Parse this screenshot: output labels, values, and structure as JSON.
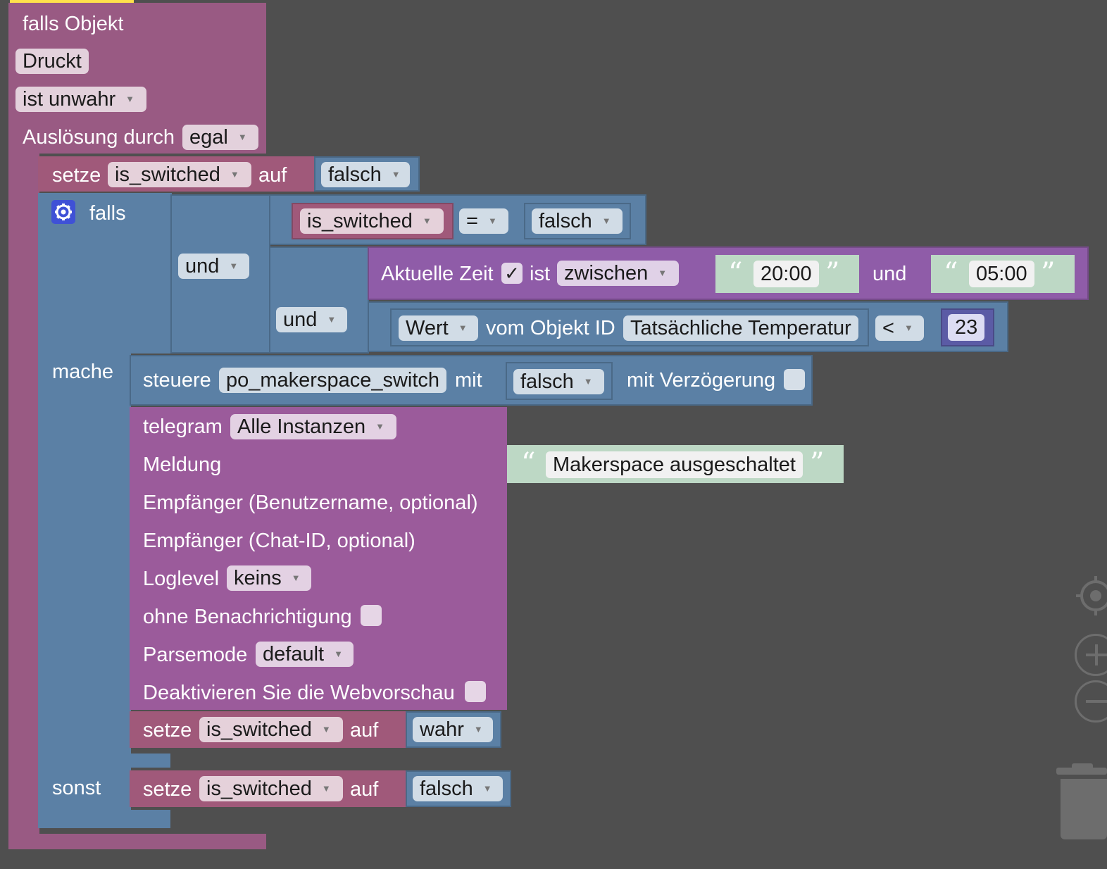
{
  "event": {
    "title": "falls Objekt",
    "object": "Druckt",
    "condition": "ist unwahr",
    "trigger_label": "Auslösung durch",
    "trigger_value": "egal"
  },
  "set1": {
    "prefix": "setze",
    "var": "is_switched",
    "to": "auf",
    "value": "falsch"
  },
  "if_block": {
    "falls": "falls",
    "and1": "und",
    "and2": "und",
    "compare_var": "is_switched",
    "compare_op": "=",
    "compare_val": "falsch",
    "time": {
      "label": "Aktuelle Zeit",
      "check": "✓",
      "ist": "ist",
      "mode": "zwischen",
      "from": "20:00",
      "und": "und",
      "to": "05:00"
    },
    "value_cmp": {
      "wert": "Wert",
      "vom": "vom Objekt ID",
      "object": "Tatsächliche Temperatur",
      "op": "<",
      "num": "23"
    },
    "mache": "mache",
    "sonst": "sonst"
  },
  "control": {
    "label": "steuere",
    "object": "po_makerspace_switch",
    "mit": "mit",
    "value": "falsch",
    "delay": "mit Verzögerung"
  },
  "telegram": {
    "label": "telegram",
    "instance": "Alle Instanzen",
    "message_label": "Meldung",
    "message": "Makerspace ausgeschaltet",
    "user_label": "Empfänger (Benutzername, optional)",
    "chat_label": "Empfänger (Chat-ID, optional)",
    "loglevel_label": "Loglevel",
    "loglevel": "keins",
    "silent_label": "ohne Benachrichtigung",
    "parsemode_label": "Parsemode",
    "parsemode": "default",
    "webpreview_label": "Deaktivieren Sie die Webvorschau"
  },
  "set2": {
    "prefix": "setze",
    "var": "is_switched",
    "to": "auf",
    "value": "wahr"
  },
  "set3": {
    "prefix": "setze",
    "var": "is_switched",
    "to": "auf",
    "value": "falsch"
  },
  "icons": [
    "gear-icon",
    "target-icon",
    "zoom-in-icon",
    "zoom-out-icon",
    "trash-icon",
    "dropdown-arrow-icon"
  ],
  "colors": {
    "event": "#995a83",
    "variable": "#a0597a",
    "logic": "#5b80a5",
    "telegram": "#9b5b9b",
    "time": "#8f5ca8",
    "text": "#bdd8c5",
    "number": "#5b5ba5",
    "workspace": "#4f4f4f"
  }
}
